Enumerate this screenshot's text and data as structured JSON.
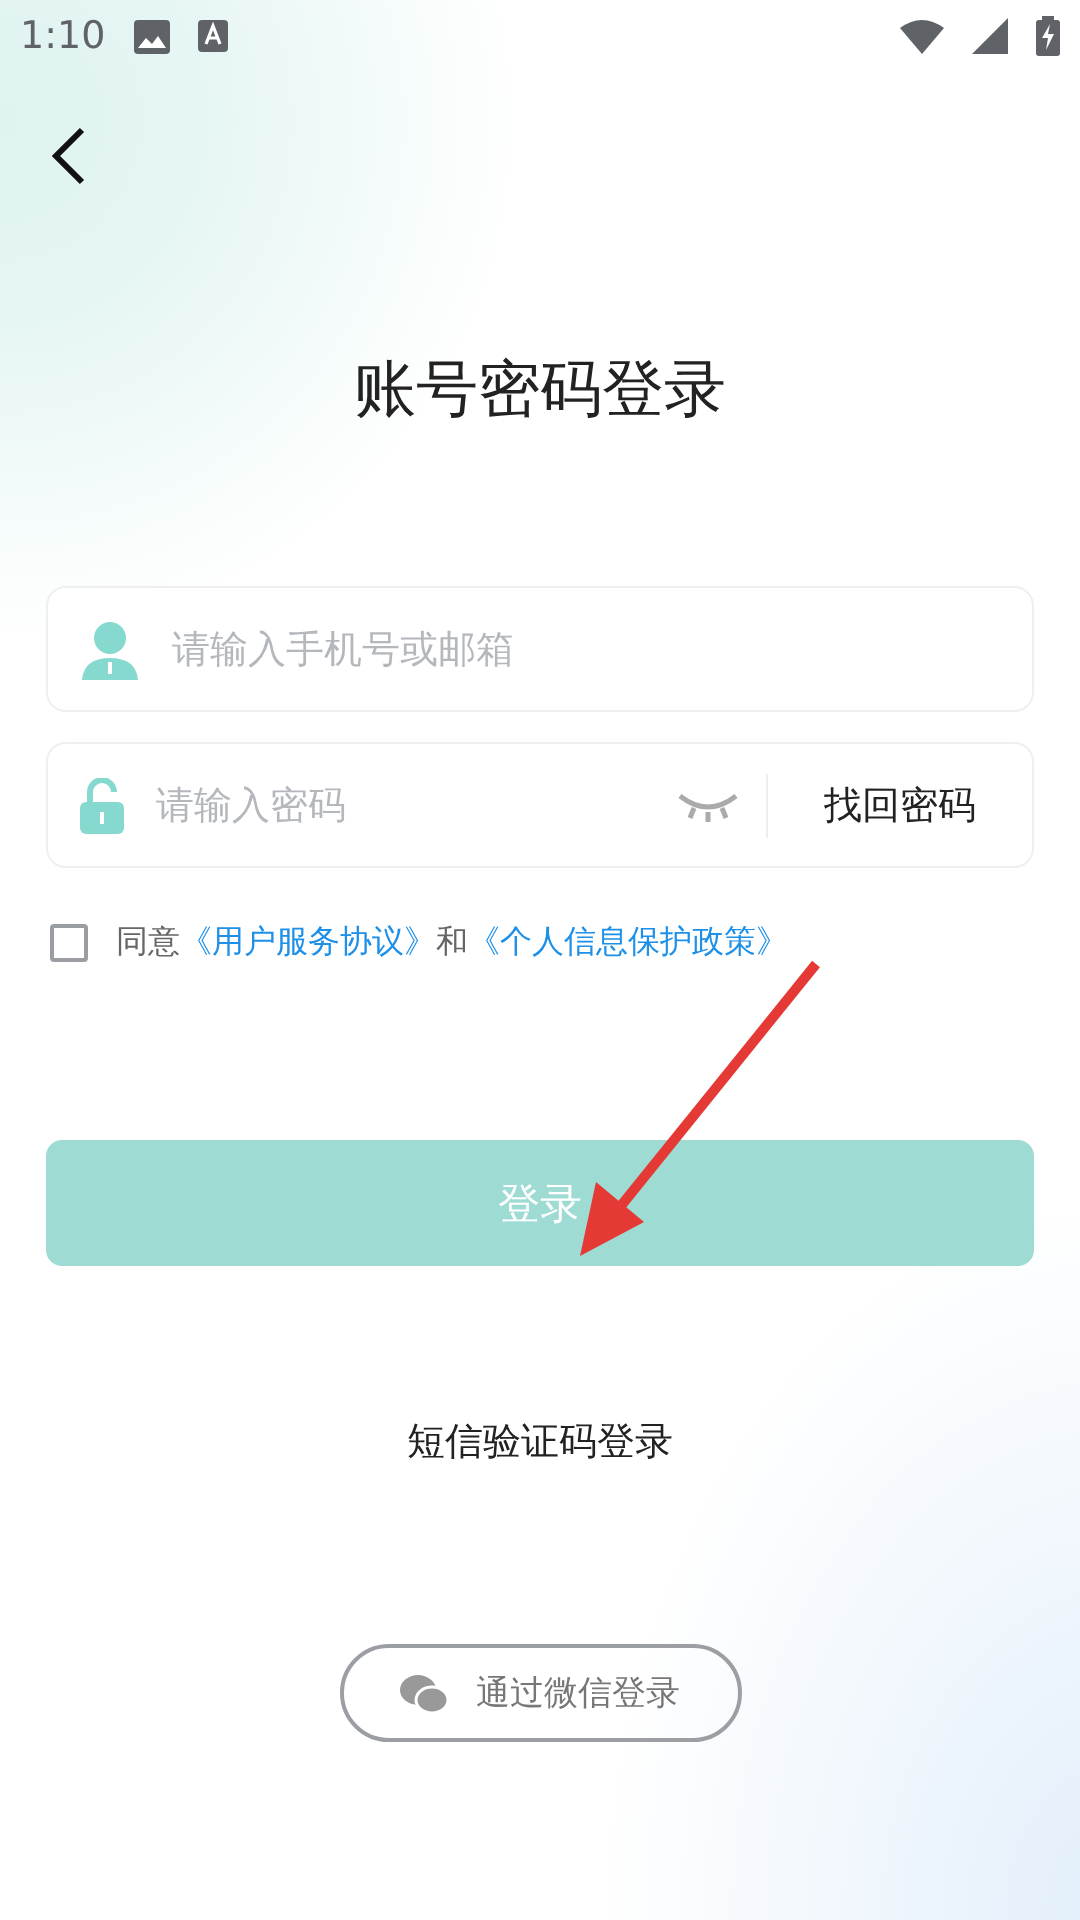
{
  "status_bar": {
    "time": "1:10"
  },
  "title": "账号密码登录",
  "account_field": {
    "placeholder": "请输入手机号或邮箱"
  },
  "password_field": {
    "placeholder": "请输入密码",
    "show_password": false,
    "recover_link": "找回密码"
  },
  "agreement": {
    "checked": false,
    "prefix": "同意",
    "links": [
      "《用户服务协议》",
      "《个人信息保护政策》"
    ],
    "joiner": "和"
  },
  "login_button": {
    "label": "登录",
    "disabled": true
  },
  "sms_login": "短信验证码登录",
  "wechat_button": {
    "label": "通过微信登录"
  }
}
